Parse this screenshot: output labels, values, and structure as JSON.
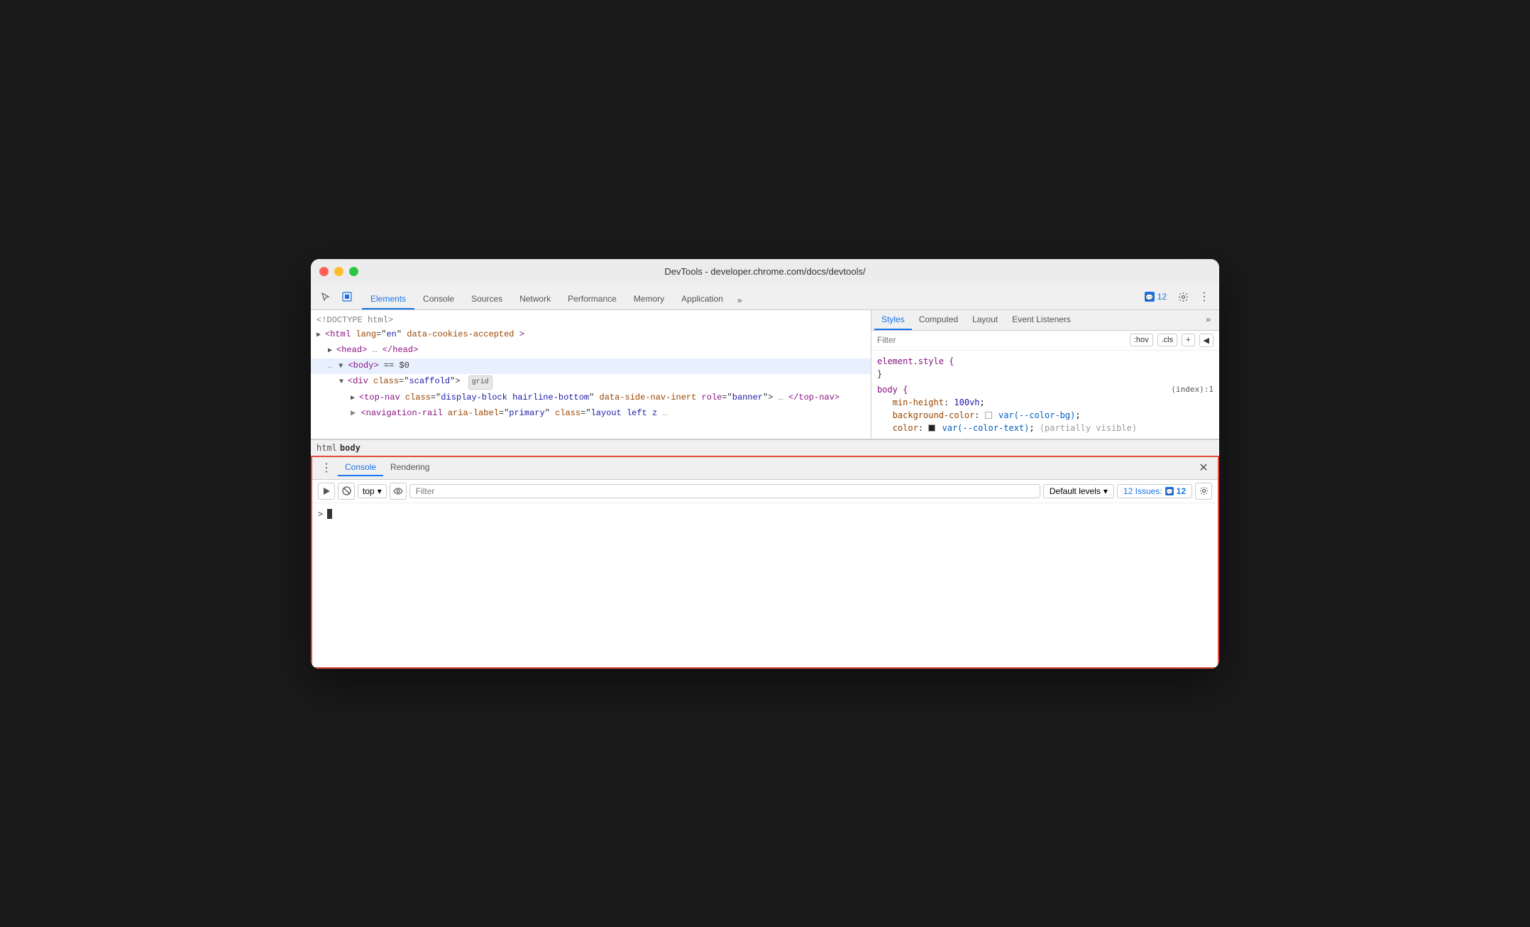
{
  "window": {
    "title": "DevTools - developer.chrome.com/docs/devtools/"
  },
  "toolbar": {
    "tabs": [
      {
        "label": "Elements",
        "active": true
      },
      {
        "label": "Console",
        "active": false
      },
      {
        "label": "Sources",
        "active": false
      },
      {
        "label": "Network",
        "active": false
      },
      {
        "label": "Performance",
        "active": false
      },
      {
        "label": "Memory",
        "active": false
      },
      {
        "label": "Application",
        "active": false
      }
    ],
    "more_label": "»",
    "issues_count": "12",
    "settings_label": "⚙",
    "more_options_label": "⋮"
  },
  "elements_panel": {
    "lines": [
      {
        "text": "<!DOCTYPE html>",
        "type": "comment",
        "indent": 0
      },
      {
        "text": "",
        "type": "html-lang",
        "indent": 0
      },
      {
        "text": "",
        "type": "head",
        "indent": 0
      },
      {
        "text": "",
        "type": "body",
        "indent": 0
      },
      {
        "text": "",
        "type": "div-scaffold",
        "indent": 1
      },
      {
        "text": "",
        "type": "top-nav",
        "indent": 2
      },
      {
        "text": "",
        "type": "nav-inert",
        "indent": 2
      }
    ],
    "breadcrumb": [
      "html",
      "body"
    ]
  },
  "styles_panel": {
    "tabs": [
      {
        "label": "Styles",
        "active": true
      },
      {
        "label": "Computed",
        "active": false
      },
      {
        "label": "Layout",
        "active": false
      },
      {
        "label": "Event Listeners",
        "active": false
      }
    ],
    "filter_placeholder": "Filter",
    "hov_button": ":hov",
    "cls_button": ".cls",
    "plus_button": "+",
    "toggle_button": "◀",
    "rules": [
      {
        "selector": "element.style {",
        "close": "}",
        "props": []
      },
      {
        "selector": "body {",
        "source": "(index):1",
        "close": "}",
        "props": [
          {
            "name": "min-height",
            "value": "100vh",
            "has_colon": true
          },
          {
            "name": "background-color",
            "value": "var(--color-bg)",
            "has_swatch": true
          },
          {
            "name": "color",
            "value": "var(--color-text)",
            "has_swatch_dark": true,
            "partial": true
          }
        ]
      }
    ]
  },
  "console_panel": {
    "tabs": [
      {
        "label": "Console",
        "active": true
      },
      {
        "label": "Rendering",
        "active": false
      }
    ],
    "filter_placeholder": "Filter",
    "top_label": "top",
    "default_levels_label": "Default levels",
    "issues_label": "12 Issues:",
    "issues_count": "12",
    "close_label": "✕",
    "prompt": ">"
  }
}
